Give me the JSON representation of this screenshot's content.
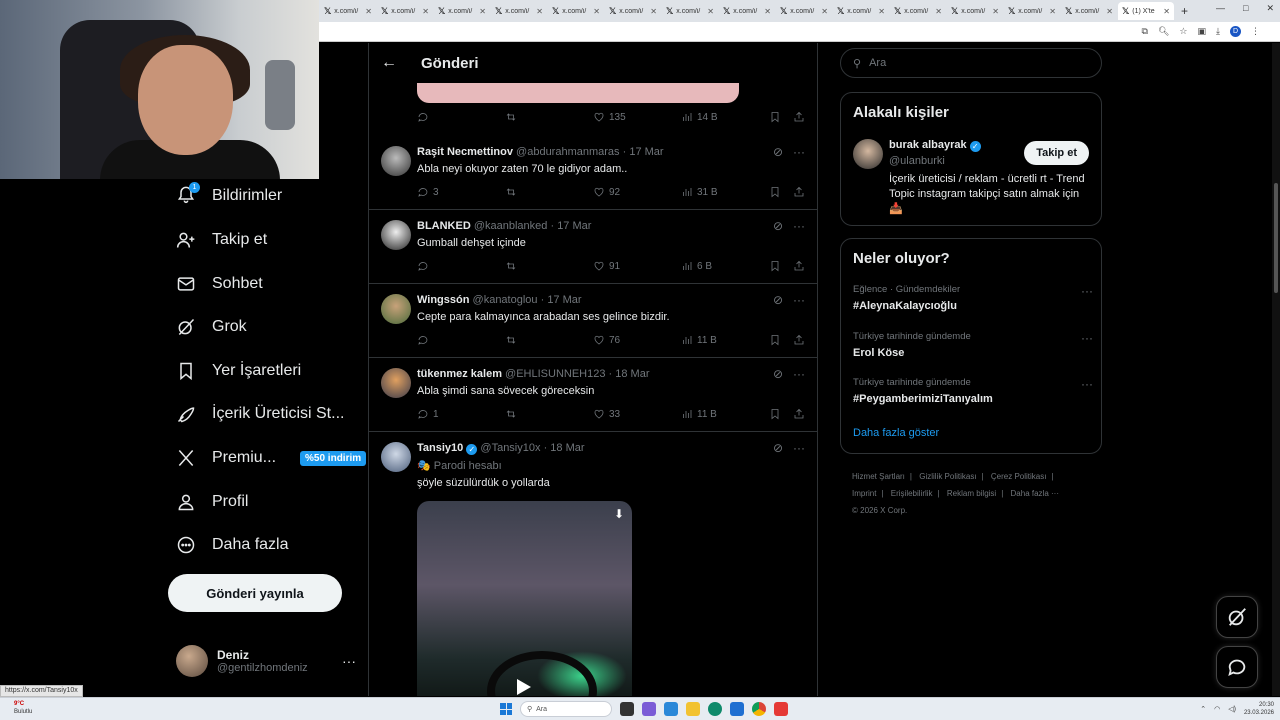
{
  "browser": {
    "tabs": [
      {
        "label": "x.com/i/"
      },
      {
        "label": "x.com/i/"
      },
      {
        "label": "x.com/i/"
      },
      {
        "label": "x.com/i/"
      },
      {
        "label": "x.com/i/"
      },
      {
        "label": "x.com/i/"
      },
      {
        "label": "x.com/i/"
      },
      {
        "label": "x.com/i/"
      },
      {
        "label": "x.com/i/"
      },
      {
        "label": "x.com/i/"
      },
      {
        "label": "x.com/i/"
      },
      {
        "label": "x.com/i/"
      },
      {
        "label": "x.com/i/"
      },
      {
        "label": "x.com/i/"
      },
      {
        "label": "(1) X'te"
      }
    ],
    "profile_initial": "D"
  },
  "nav": {
    "notif_count": "1",
    "items": [
      {
        "label": "Bildirimler",
        "icon": "bell-icon"
      },
      {
        "label": "Takip et",
        "icon": "person-plus-icon"
      },
      {
        "label": "Sohbet",
        "icon": "mail-icon"
      },
      {
        "label": "Grok",
        "icon": "grok-icon"
      },
      {
        "label": "Yer İşaretleri",
        "icon": "bookmark-icon"
      },
      {
        "label": "İçerik Üreticisi St...",
        "icon": "rocket-icon"
      },
      {
        "label": "Premiu...",
        "icon": "x-logo-icon"
      },
      {
        "label": "Profil",
        "icon": "person-icon"
      },
      {
        "label": "Daha fazla",
        "icon": "more-circle-icon"
      }
    ],
    "premium_badge": "%50 indirim",
    "post_button": "Gönderi yayınla",
    "account": {
      "name": "Deniz",
      "handle": "@gentilzhomdeniz",
      "more": "···"
    }
  },
  "main": {
    "header_title": "Gönderi",
    "prev_stats": {
      "likes": "135",
      "views": "14 B"
    },
    "tweets": [
      {
        "name": "Raşit Necmettinov",
        "handle": "@abdurahmanmaras",
        "date": "· 17 Mar",
        "text": "Abla neyi okuyor zaten 70 le gidiyor adam..",
        "replies": "3",
        "likes": "92",
        "views": "31 B"
      },
      {
        "name": "BLANKED",
        "handle": "@kaanblanked",
        "date": "· 17 Mar",
        "text": "Gumball dehşet içinde",
        "replies": "",
        "likes": "91",
        "views": "6 B"
      },
      {
        "name": "Wingssón",
        "handle": "@kanatoglou",
        "date": "· 17 Mar",
        "text": "Cepte para kalmayınca arabadan ses gelince bizdir.",
        "replies": "",
        "likes": "76",
        "views": "11 B"
      },
      {
        "name": "tükenmez kalem",
        "handle": "@EHLISUNNEH123",
        "date": "· 18 Mar",
        "text": "Abla şimdi sana sövecek göreceksin",
        "replies": "1",
        "likes": "33",
        "views": "11 B"
      }
    ],
    "last_tweet": {
      "name": "Tansiy10",
      "handle": "@Tansiy10x",
      "date": "· 18 Mar",
      "parody": "Parodi hesabı",
      "text": "şöyle süzülürdük o yollarda"
    }
  },
  "right": {
    "search_placeholder": "Ara",
    "related_title": "Alakalı kişiler",
    "person": {
      "name": "burak albayrak",
      "handle": "@ulanburki",
      "bio": "İçerik üreticisi / reklam - ücretli rt - Trend Topic instagram takipçi satın almak için 📥",
      "follow": "Takip et"
    },
    "trends_title": "Neler oluyor?",
    "trends": [
      {
        "category": "Eğlence · Gündemdekiler",
        "title": "#AleynaKalaycıoğlu"
      },
      {
        "category": "Türkiye tarihinde gündemde",
        "title": "Erol Köse"
      },
      {
        "category": "Türkiye tarihinde gündemde",
        "title": "#PeygamberimiziTanıyalım"
      }
    ],
    "show_more": "Daha fazla göster",
    "footer": [
      "Hizmet Şartları",
      "Gizlilik Politikası",
      "Çerez Politikası",
      "Imprint",
      "Erişilebilirlik",
      "Reklam bilgisi",
      "Daha fazla ···"
    ],
    "copyright": "© 2026 X Corp."
  },
  "status_url": "https://x.com/Tansiy10x",
  "taskbar": {
    "weather_temp": "9°C",
    "weather_text": "Bulutlu",
    "search": "Ara",
    "time": "20:30",
    "date": "23.03.2026"
  }
}
